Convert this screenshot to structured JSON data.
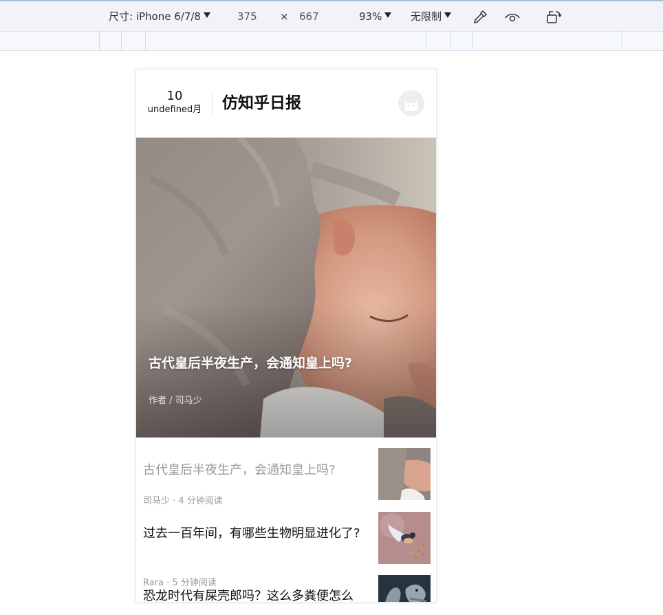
{
  "devtools": {
    "device_label": "尺寸: iPhone 6/7/8",
    "width": "375",
    "times": "×",
    "height": "667",
    "zoom": "93%",
    "throttle": "无限制"
  },
  "header": {
    "day": "10",
    "month": "undefined月",
    "title": "仿知乎日报"
  },
  "hero": {
    "title": "古代皇后半夜生产，会通知皇上吗?",
    "author": "作者 / 司马少",
    "slide_count": 5,
    "active_slide": 1
  },
  "stories": [
    {
      "title": "古代皇后半夜生产，会通知皇上吗?",
      "meta": "司马少 · 4 分钟阅读",
      "read": true,
      "thumb": "sleeping-baby"
    },
    {
      "title": "过去一百年间，有哪些生物明显进化了?",
      "meta": "Rara · 5 分钟阅读",
      "read": false,
      "thumb": "bird"
    },
    {
      "title": "恐龙时代有屎壳郎吗？这么多粪便怎么",
      "meta": "",
      "read": false,
      "thumb": "lizard"
    }
  ]
}
